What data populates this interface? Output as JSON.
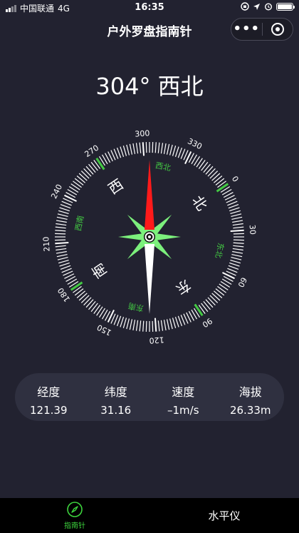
{
  "status_bar": {
    "carrier": "中国联通",
    "network": "4G",
    "time": "16:35"
  },
  "nav": {
    "title": "户外罗盘指南针",
    "more_label": "•••"
  },
  "compass": {
    "heading_degrees": 304,
    "heading_text": "304° 西北",
    "degree_labels": [
      "0",
      "30",
      "60",
      "90",
      "120",
      "150",
      "180",
      "210",
      "240",
      "270",
      "300",
      "330"
    ],
    "cardinal_labels": [
      "北",
      "东",
      "南",
      "西"
    ],
    "intercardinal_labels": [
      "东北",
      "东南",
      "西南",
      "西北"
    ],
    "colors": {
      "ticks": "#ffffff",
      "highlight_ticks": "#43c943",
      "intercardinal_text": "#43c943",
      "needle_north": "#ff1a1a",
      "needle_south": "#ffffff",
      "star": "#7cf07c"
    }
  },
  "info": [
    {
      "label": "经度",
      "value": "121.39"
    },
    {
      "label": "纬度",
      "value": "31.16"
    },
    {
      "label": "速度",
      "value": "–1m/s"
    },
    {
      "label": "海拔",
      "value": "26.33m"
    }
  ],
  "tabs": [
    {
      "label": "指南针",
      "icon": "compass-icon",
      "active": true
    },
    {
      "label": "水平仪",
      "active": false
    }
  ]
}
